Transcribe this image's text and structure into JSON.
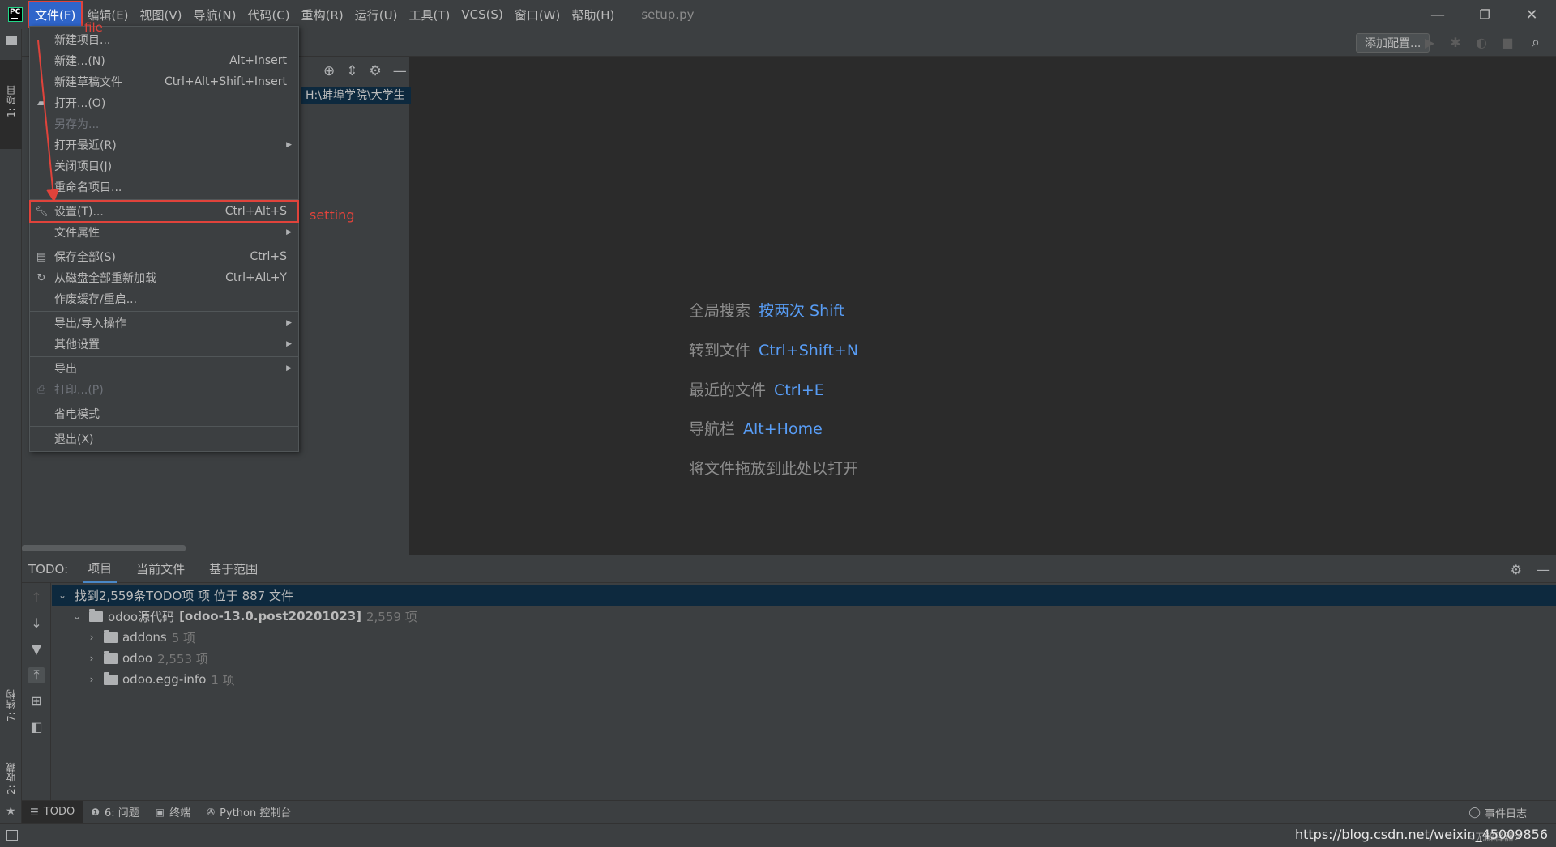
{
  "menubar": {
    "items": [
      "文件(F)",
      "编辑(E)",
      "视图(V)",
      "导航(N)",
      "代码(C)",
      "重构(R)",
      "运行(U)",
      "工具(T)",
      "VCS(S)",
      "窗口(W)",
      "帮助(H)"
    ],
    "window_title": "setup.py"
  },
  "window_controls": {
    "minimize": "—",
    "restore": "❐",
    "close": "✕"
  },
  "left_stripe": {
    "project_tab": "1: 项目",
    "structure_tab": "7: 结构",
    "favorites_tab": "2: 收藏"
  },
  "toolbar": {
    "add_config": "添加配置..."
  },
  "project_panel": {
    "path": "H:\\蚌埠学院\\大学生"
  },
  "file_menu": {
    "items": [
      {
        "label": "新建项目...",
        "shortcut": ""
      },
      {
        "label": "新建...(N)",
        "shortcut": "Alt+Insert"
      },
      {
        "label": "新建草稿文件",
        "shortcut": "Ctrl+Alt+Shift+Insert"
      },
      {
        "label": "打开...(O)",
        "shortcut": ""
      },
      {
        "label": "另存为...",
        "shortcut": ""
      },
      {
        "label": "打开最近(R)",
        "shortcut": ""
      },
      {
        "label": "关闭项目(J)",
        "shortcut": ""
      },
      {
        "label": "重命名项目...",
        "shortcut": ""
      },
      {
        "label": "设置(T)...",
        "shortcut": "Ctrl+Alt+S"
      },
      {
        "label": "文件属性",
        "shortcut": ""
      },
      {
        "label": "保存全部(S)",
        "shortcut": "Ctrl+S"
      },
      {
        "label": "从磁盘全部重新加载",
        "shortcut": "Ctrl+Alt+Y"
      },
      {
        "label": "作废缓存/重启...",
        "shortcut": ""
      },
      {
        "label": "导出/导入操作",
        "shortcut": ""
      },
      {
        "label": "其他设置",
        "shortcut": ""
      },
      {
        "label": "导出",
        "shortcut": ""
      },
      {
        "label": "打印...(P)",
        "shortcut": ""
      },
      {
        "label": "省电模式",
        "shortcut": ""
      },
      {
        "label": "退出(X)",
        "shortcut": ""
      }
    ]
  },
  "annotations": {
    "file": "file",
    "setting": "setting"
  },
  "editor_hints": [
    {
      "text": "全局搜索",
      "key": "按两次 Shift"
    },
    {
      "text": "转到文件",
      "key": "Ctrl+Shift+N"
    },
    {
      "text": "最近的文件",
      "key": "Ctrl+E"
    },
    {
      "text": "导航栏",
      "key": "Alt+Home"
    },
    {
      "text": "将文件拖放到此处以打开",
      "key": ""
    }
  ],
  "todo": {
    "label": "TODO:",
    "tabs": [
      "项目",
      "当前文件",
      "基于范围"
    ],
    "summary": "找到2,559条TODO项 项 位于 887 文件",
    "root": {
      "name": "odoo源代码",
      "bold": "[odoo-13.0.post20201023]",
      "count": "2,559 项"
    },
    "children": [
      {
        "name": "addons",
        "count": "5 项"
      },
      {
        "name": "odoo",
        "count": "2,553 项"
      },
      {
        "name": "odoo.egg-info",
        "count": "1 项"
      }
    ]
  },
  "bottom_tools": {
    "items": [
      "TODO",
      "6: 问题",
      "终端",
      "Python 控制台"
    ],
    "event_log": "事件日志"
  },
  "status_bar": {
    "watermark": "https://blog.csdn.net/weixin_45009856",
    "right_text": "<无解释器>"
  },
  "colors": {
    "accent": "#589df6",
    "annotation": "#e0433b",
    "selection": "#0d293e",
    "menu_active": "#2f65ca"
  }
}
